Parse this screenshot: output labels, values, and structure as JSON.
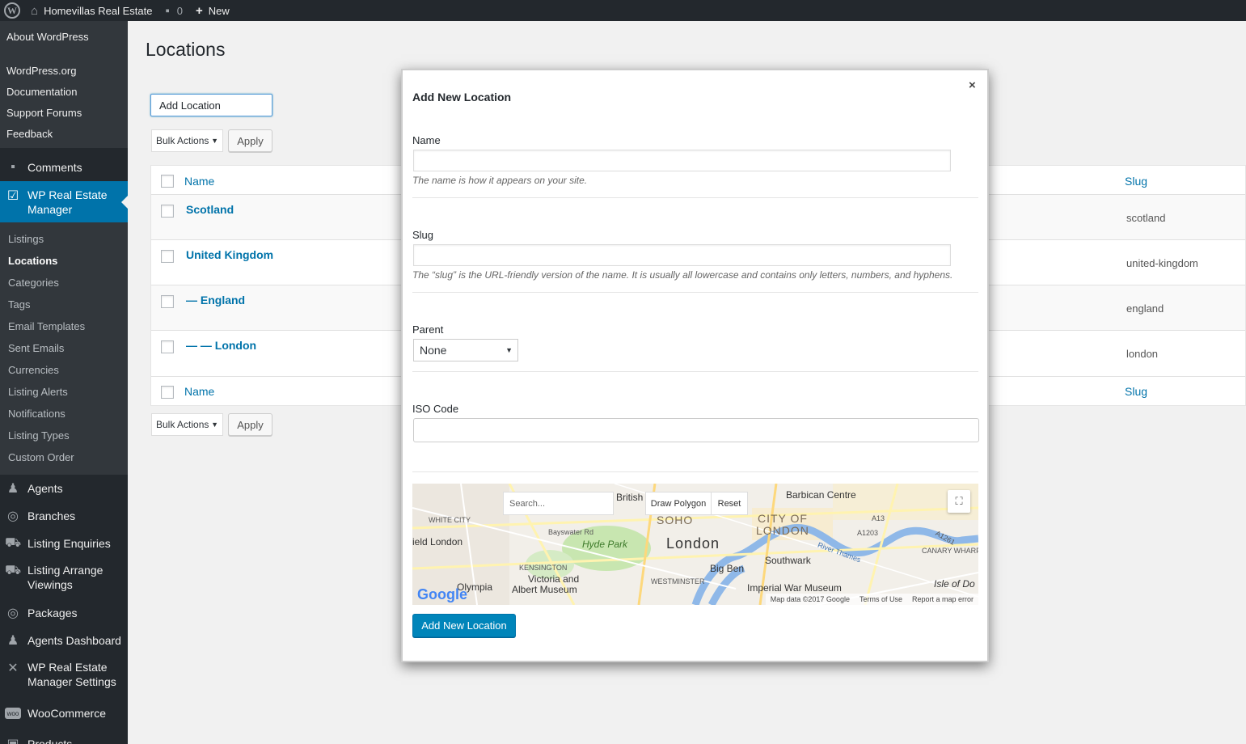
{
  "adminbar": {
    "site_name": "Homevillas Real Estate",
    "comments_count": "0",
    "new_label": "New"
  },
  "sidebar": {
    "top_links": [
      "About WordPress",
      "WordPress.org",
      "Documentation",
      "Support Forums",
      "Feedback"
    ],
    "comments": "Comments",
    "current_menu": "WP Real Estate Manager",
    "submenu": [
      "Listings",
      "Locations",
      "Categories",
      "Tags",
      "Email Templates",
      "Sent Emails",
      "Currencies",
      "Listing Alerts",
      "Notifications",
      "Listing Types",
      "Custom Order"
    ],
    "active_submenu": "Locations",
    "menu": [
      "Agents",
      "Branches",
      "Listing Enquiries",
      "Listing Arrange Viewings",
      "Packages",
      "Agents Dashboard",
      "WP Real Estate Manager Settings",
      "WooCommerce",
      "Products"
    ]
  },
  "page": {
    "title": "Locations",
    "add_button": "Add Location",
    "bulk_actions": "Bulk Actions",
    "apply": "Apply",
    "columns": {
      "name": "Name",
      "slug": "Slug"
    },
    "rows": [
      {
        "name": "Scotland",
        "slug": "scotland"
      },
      {
        "name": "United Kingdom",
        "slug": "united-kingdom"
      },
      {
        "name": "— England",
        "slug": "england"
      },
      {
        "name": "— — London",
        "slug": "london"
      }
    ]
  },
  "modal": {
    "title": "Add New Location",
    "close": "×",
    "name_label": "Name",
    "name_desc": "The name is how it appears on your site.",
    "slug_label": "Slug",
    "slug_desc": "The “slug” is the URL-friendly version of the name. It is usually all lowercase and contains only letters, numbers, and hyphens.",
    "parent_label": "Parent",
    "parent_value": "None",
    "iso_label": "ISO Code",
    "submit": "Add New Location",
    "map": {
      "search_placeholder": "Search...",
      "draw_polygon": "Draw Polygon",
      "reset": "Reset",
      "city": "London",
      "labels": [
        "SOHO",
        "CITY OF",
        "LONDON",
        "Hyde Park",
        "Southwark",
        "Big Ben",
        "Barbican Centre",
        "Imperial War Museum",
        "Victoria and",
        "Albert Museum",
        "Olympia",
        "ield London",
        "WHITE CITY",
        "KENSINGTON",
        "WESTMINSTER",
        "Bayswater Rd",
        "Isle of Do",
        "CANARY WHARF",
        "British",
        "River Thames",
        "A13",
        "A1203",
        "A1261"
      ],
      "footer": [
        "Map data ©2017 Google",
        "Terms of Use",
        "Report a map error"
      ],
      "logo": "Google"
    }
  }
}
